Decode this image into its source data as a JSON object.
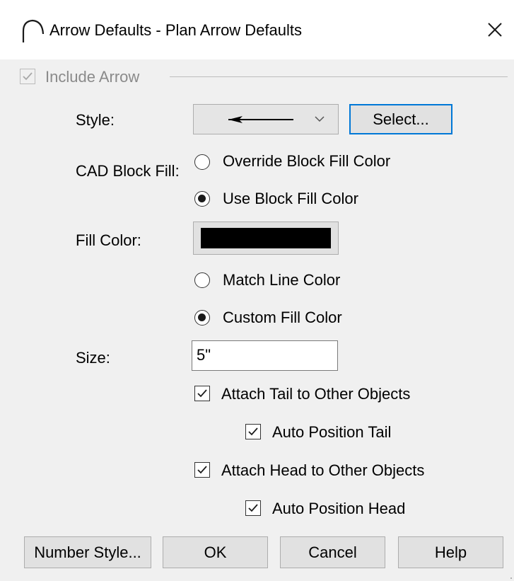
{
  "window": {
    "title": "Arrow Defaults - Plan Arrow Defaults",
    "icon": "arc-icon",
    "close_icon": "close-icon"
  },
  "include_arrow": {
    "label": "Include Arrow",
    "checked": true,
    "enabled": false
  },
  "style": {
    "label": "Style:",
    "selected_icon": "arrow-left-line",
    "select_button": "Select..."
  },
  "cad_block_fill": {
    "label": "CAD Block Fill:",
    "options": [
      {
        "label": "Override Block Fill Color",
        "selected": false
      },
      {
        "label": "Use Block Fill Color",
        "selected": true
      }
    ]
  },
  "fill_color": {
    "label": "Fill Color:",
    "swatch": "#000000",
    "options": [
      {
        "label": "Match Line Color",
        "selected": false
      },
      {
        "label": "Custom Fill Color",
        "selected": true
      }
    ]
  },
  "size": {
    "label": "Size:",
    "value": "5\""
  },
  "checkboxes": [
    {
      "label": "Attach Tail to Other Objects",
      "checked": true
    },
    {
      "label": "Auto Position Tail",
      "checked": true
    },
    {
      "label": "Attach Head to Other Objects",
      "checked": true
    },
    {
      "label": "Auto Position Head",
      "checked": true
    }
  ],
  "buttons": {
    "number_style": "Number Style...",
    "ok": "OK",
    "cancel": "Cancel",
    "help": "Help"
  },
  "colors": {
    "focus_border": "#0078d7",
    "button_bg": "#e1e1e1",
    "dialog_bg": "#f0f0f0"
  }
}
